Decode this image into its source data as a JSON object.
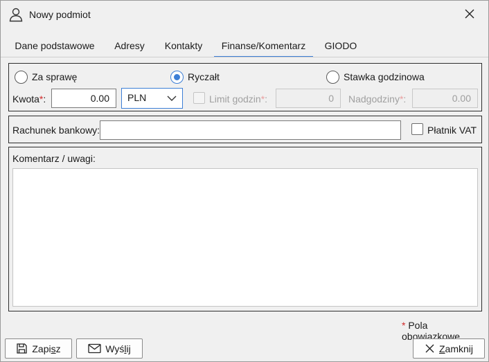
{
  "window": {
    "title": "Nowy podmiot",
    "title_icon": "user-icon",
    "close_icon": "close-icon"
  },
  "tabs": [
    {
      "label": "Dane podstawowe",
      "active": false
    },
    {
      "label": "Adresy",
      "active": false
    },
    {
      "label": "Kontakty",
      "active": false
    },
    {
      "label": "Finanse/Komentarz",
      "active": true
    },
    {
      "label": "GIODO",
      "active": false
    }
  ],
  "billing": {
    "options": [
      {
        "label": "Za sprawę",
        "checked": false
      },
      {
        "label": "Ryczałt",
        "checked": true
      },
      {
        "label": "Stawka godzinowa",
        "checked": false
      }
    ],
    "amount_label": "Kwota",
    "amount_value": "0.00",
    "currency": "PLN",
    "hour_limit_label": "Limit godzin",
    "hour_limit_value": "0",
    "hour_limit_checked": false,
    "overtime_label": "Nadgodziny",
    "overtime_value": "0.00",
    "required_mark": "*",
    "label_sep": ":"
  },
  "bank": {
    "account_label": "Rachunek bankowy:",
    "account_value": "",
    "vat_label": "Płatnik VAT",
    "vat_checked": false
  },
  "comment": {
    "label": "Komentarz / uwagi:",
    "value": ""
  },
  "footer": {
    "required_note_mark": "*",
    "required_note": " Pola obowiązkowe",
    "save": {
      "pre": "Zapi",
      "mnemonic": "s",
      "post": "z",
      "icon": "save-icon"
    },
    "send": {
      "pre": "Wyś",
      "mnemonic": "l",
      "post": "ij",
      "icon": "mail-icon"
    },
    "close": {
      "pre": "",
      "mnemonic": "Z",
      "post": "amknij",
      "icon": "close-icon"
    }
  },
  "colors": {
    "accent": "#3d7fd6",
    "required": "#d12a2a",
    "background": "#f0f0f0"
  }
}
